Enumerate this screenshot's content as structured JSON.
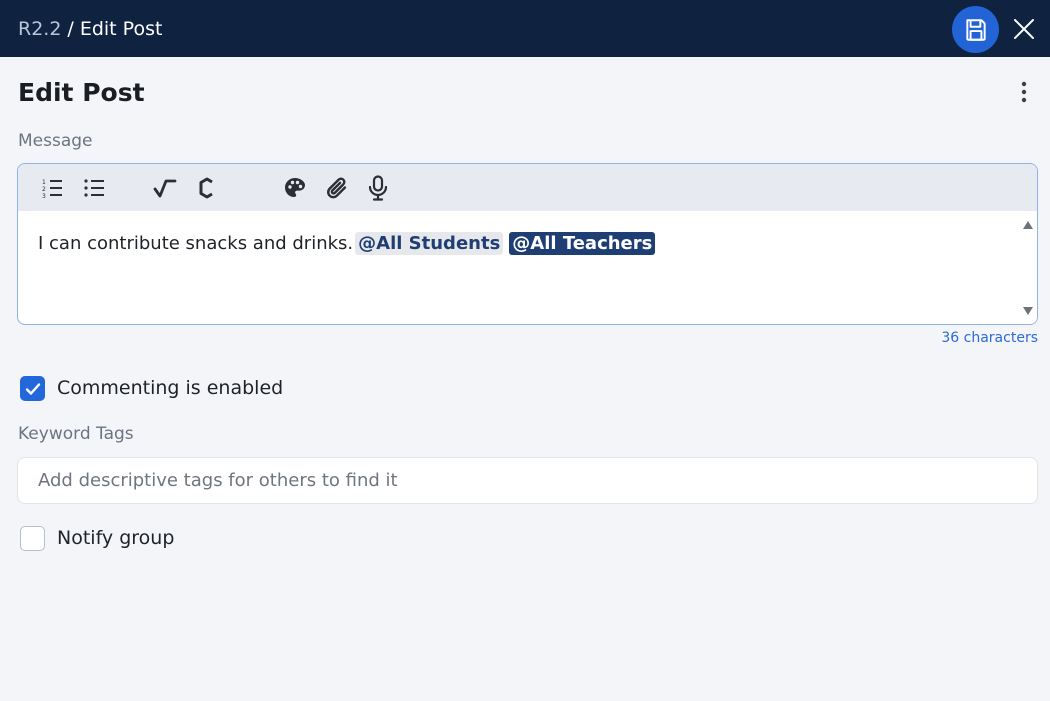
{
  "header": {
    "parent": "R2.2",
    "separator": "/",
    "title": "Edit Post"
  },
  "page": {
    "heading": "Edit Post"
  },
  "message": {
    "label": "Message",
    "text": "I can contribute snacks and drinks.",
    "mentions": [
      "@All Students",
      "@All Teachers"
    ],
    "char_count": "36 characters"
  },
  "toolbar": {
    "icons": [
      "numbered-list-icon",
      "bulleted-list-icon",
      "math-icon",
      "chemistry-icon",
      "palette-icon",
      "attachment-icon",
      "microphone-icon"
    ]
  },
  "commenting": {
    "label": "Commenting is enabled",
    "checked": true
  },
  "tags": {
    "label": "Keyword Tags",
    "placeholder": "Add descriptive tags for others to find it"
  },
  "notify": {
    "label": "Notify group",
    "checked": false
  },
  "colors": {
    "header_bg": "#0f2340",
    "accent": "#2263d6",
    "mention_dark": "#1e3e74"
  }
}
